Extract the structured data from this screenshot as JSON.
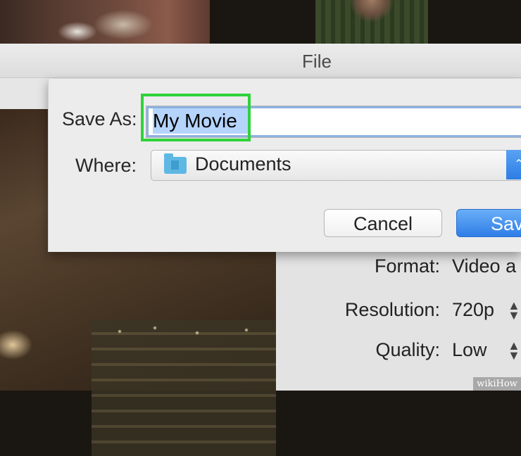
{
  "window": {
    "title": "File"
  },
  "save_sheet": {
    "save_as_label": "Save As:",
    "filename_value": "My Movie",
    "where_label": "Where:",
    "where_value": "Documents",
    "where_icon": "folder-icon",
    "cancel_label": "Cancel",
    "save_label": "Sav",
    "highlight_color": "#2fd23a",
    "accent_color": "#2f7ee7"
  },
  "settings": [
    {
      "label": "Format:",
      "value": "Video a",
      "stepper": false
    },
    {
      "label": "Resolution:",
      "value": "720p",
      "stepper": true
    },
    {
      "label": "Quality:",
      "value": "Low",
      "stepper": true
    }
  ],
  "watermark": {
    "text": "wikiHow"
  }
}
